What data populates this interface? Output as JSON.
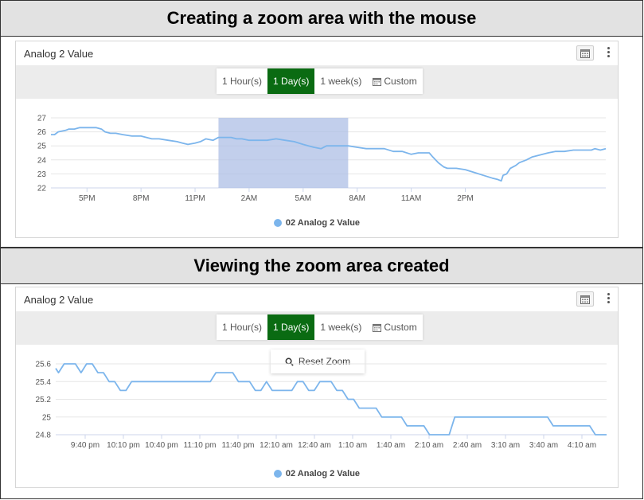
{
  "top": {
    "banner": "Creating a zoom area with the mouse",
    "card_title": "Analog 2 Value",
    "range_buttons": [
      "1 Hour(s)",
      "1 Day(s)",
      "1 week(s)",
      "Custom"
    ],
    "active_button": "1 Day(s)",
    "legend": "02 Analog 2 Value"
  },
  "bottom": {
    "banner": "Viewing the zoom area created",
    "card_title": "Analog 2 Value",
    "range_buttons": [
      "1 Hour(s)",
      "1 Day(s)",
      "1 week(s)",
      "Custom"
    ],
    "active_button": "1 Day(s)",
    "reset_zoom": "Reset Zoom",
    "legend": "02 Analog 2 Value"
  },
  "colors": {
    "series": "#7cb5ec",
    "active_button": "#0a6b12",
    "selection": "#aebfe6",
    "banner_bg": "#e2e2e2"
  },
  "chart_data": [
    {
      "type": "line",
      "series": [
        {
          "name": "02 Analog 2 Value",
          "color": "#7cb5ec"
        }
      ],
      "x_ticks": [
        "5PM",
        "8PM",
        "11PM",
        "2AM",
        "5AM",
        "8AM",
        "11AM",
        "2PM"
      ],
      "y_ticks": [
        22,
        23,
        24,
        25,
        26,
        27
      ],
      "ylim": [
        22,
        27
      ],
      "grid": true,
      "legend": "bottom-center",
      "selection_range_hours": [
        9.3,
        16.5
      ],
      "points": [
        [
          0,
          25.8
        ],
        [
          0.2,
          25.8
        ],
        [
          0.4,
          26.0
        ],
        [
          0.8,
          26.1
        ],
        [
          1.0,
          26.2
        ],
        [
          1.3,
          26.2
        ],
        [
          1.6,
          26.3
        ],
        [
          2.0,
          26.3
        ],
        [
          2.5,
          26.3
        ],
        [
          2.8,
          26.2
        ],
        [
          3.0,
          26.0
        ],
        [
          3.3,
          25.9
        ],
        [
          3.6,
          25.9
        ],
        [
          4.0,
          25.8
        ],
        [
          4.5,
          25.7
        ],
        [
          5.0,
          25.7
        ],
        [
          5.3,
          25.6
        ],
        [
          5.6,
          25.5
        ],
        [
          6.0,
          25.5
        ],
        [
          6.5,
          25.4
        ],
        [
          7.0,
          25.3
        ],
        [
          7.3,
          25.2
        ],
        [
          7.6,
          25.1
        ],
        [
          8.0,
          25.2
        ],
        [
          8.3,
          25.3
        ],
        [
          8.6,
          25.5
        ],
        [
          9.0,
          25.4
        ],
        [
          9.3,
          25.6
        ],
        [
          9.6,
          25.6
        ],
        [
          10.0,
          25.6
        ],
        [
          10.3,
          25.5
        ],
        [
          10.6,
          25.5
        ],
        [
          11.0,
          25.4
        ],
        [
          11.5,
          25.4
        ],
        [
          12.0,
          25.4
        ],
        [
          12.5,
          25.5
        ],
        [
          13.0,
          25.4
        ],
        [
          13.5,
          25.3
        ],
        [
          14.0,
          25.1
        ],
        [
          14.3,
          25.0
        ],
        [
          14.6,
          24.9
        ],
        [
          15.0,
          24.8
        ],
        [
          15.3,
          25.0
        ],
        [
          15.6,
          25.0
        ],
        [
          16.0,
          25.0
        ],
        [
          16.5,
          25.0
        ],
        [
          17.0,
          24.9
        ],
        [
          17.5,
          24.8
        ],
        [
          18.0,
          24.8
        ],
        [
          18.5,
          24.8
        ],
        [
          19.0,
          24.6
        ],
        [
          19.5,
          24.6
        ],
        [
          20.0,
          24.4
        ],
        [
          20.4,
          24.5
        ],
        [
          21.0,
          24.5
        ],
        [
          21.2,
          24.2
        ],
        [
          21.5,
          23.8
        ],
        [
          21.8,
          23.5
        ],
        [
          22.0,
          23.4
        ],
        [
          22.5,
          23.4
        ],
        [
          23.0,
          23.3
        ],
        [
          23.5,
          23.1
        ],
        [
          24.0,
          22.9
        ],
        [
          24.5,
          22.7
        ],
        [
          24.8,
          22.6
        ],
        [
          25.0,
          22.5
        ],
        [
          25.1,
          22.9
        ],
        [
          25.3,
          23.0
        ],
        [
          25.5,
          23.4
        ],
        [
          25.8,
          23.6
        ],
        [
          26.0,
          23.8
        ],
        [
          26.4,
          24.0
        ],
        [
          26.7,
          24.2
        ],
        [
          27.0,
          24.3
        ],
        [
          27.3,
          24.4
        ],
        [
          27.6,
          24.5
        ],
        [
          28.0,
          24.6
        ],
        [
          28.5,
          24.6
        ],
        [
          29.0,
          24.7
        ],
        [
          29.5,
          24.7
        ],
        [
          30.0,
          24.7
        ],
        [
          30.2,
          24.8
        ],
        [
          30.5,
          24.7
        ],
        [
          30.8,
          24.8
        ]
      ]
    },
    {
      "type": "line",
      "series": [
        {
          "name": "02 Analog 2 Value",
          "color": "#7cb5ec"
        }
      ],
      "x_ticks": [
        "9:40 pm",
        "10:10 pm",
        "10:40 pm",
        "11:10 pm",
        "11:40 pm",
        "12:10 am",
        "12:40 am",
        "1:10 am",
        "1:40 am",
        "2:10 am",
        "2:40 am",
        "3:10 am",
        "3:40 am",
        "4:10 am"
      ],
      "y_ticks": [
        24.8,
        25,
        25.2,
        25.4,
        25.6
      ],
      "ylim": [
        24.8,
        25.6
      ],
      "grid": true,
      "legend": "bottom-center",
      "points": [
        [
          0,
          25.55
        ],
        [
          2,
          25.5
        ],
        [
          6,
          25.6
        ],
        [
          10,
          25.6
        ],
        [
          14,
          25.6
        ],
        [
          18,
          25.5
        ],
        [
          22,
          25.6
        ],
        [
          26,
          25.6
        ],
        [
          30,
          25.5
        ],
        [
          34,
          25.5
        ],
        [
          38,
          25.4
        ],
        [
          42,
          25.4
        ],
        [
          46,
          25.3
        ],
        [
          50,
          25.3
        ],
        [
          54,
          25.4
        ],
        [
          58,
          25.4
        ],
        [
          90,
          25.4
        ],
        [
          110,
          25.4
        ],
        [
          114,
          25.5
        ],
        [
          118,
          25.5
        ],
        [
          126,
          25.5
        ],
        [
          130,
          25.4
        ],
        [
          138,
          25.4
        ],
        [
          142,
          25.3
        ],
        [
          146,
          25.3
        ],
        [
          150,
          25.4
        ],
        [
          154,
          25.3
        ],
        [
          160,
          25.3
        ],
        [
          168,
          25.3
        ],
        [
          172,
          25.4
        ],
        [
          176,
          25.4
        ],
        [
          180,
          25.3
        ],
        [
          184,
          25.3
        ],
        [
          188,
          25.4
        ],
        [
          196,
          25.4
        ],
        [
          200,
          25.3
        ],
        [
          204,
          25.3
        ],
        [
          208,
          25.2
        ],
        [
          212,
          25.2
        ],
        [
          216,
          25.1
        ],
        [
          220,
          25.1
        ],
        [
          228,
          25.1
        ],
        [
          232,
          25.0
        ],
        [
          236,
          25.0
        ],
        [
          246,
          25.0
        ],
        [
          250,
          24.9
        ],
        [
          254,
          24.9
        ],
        [
          262,
          24.9
        ],
        [
          266,
          24.8
        ],
        [
          280,
          24.8
        ],
        [
          284,
          25.0
        ],
        [
          300,
          25.0
        ],
        [
          330,
          25.0
        ],
        [
          350,
          25.0
        ],
        [
          354,
          24.9
        ],
        [
          362,
          24.9
        ],
        [
          380,
          24.9
        ],
        [
          384,
          24.8
        ],
        [
          392,
          24.8
        ]
      ]
    }
  ]
}
